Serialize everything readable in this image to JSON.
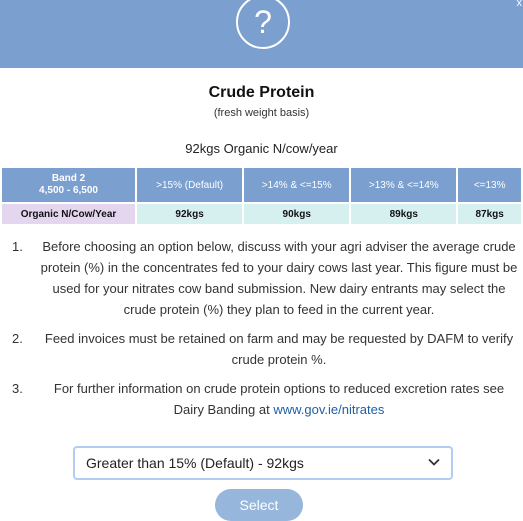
{
  "header": {
    "help_glyph": "?",
    "close_glyph": "x"
  },
  "dialog": {
    "title": "Crude Protein",
    "subtitle": "(fresh weight basis)",
    "summary": "92kgs Organic N/cow/year"
  },
  "table": {
    "band_line1": "Band 2",
    "band_line2": "4,500 - 6,500",
    "columns": [
      ">15% (Default)",
      ">14% & <=15%",
      ">13% & <=14%",
      "<=13%"
    ],
    "row_label": "Organic N/Cow/Year",
    "values": [
      "92kgs",
      "90kgs",
      "89kgs",
      "87kgs"
    ]
  },
  "notes": [
    {
      "num": "1.",
      "text": "Before choosing an option below, discuss with your agri adviser the average crude protein (%) in the concentrates fed to your dairy cows last year. This figure must be used for your nitrates cow band submission. New dairy entrants may select the crude protein (%) they plan to feed in the current year."
    },
    {
      "num": "2.",
      "text": "Feed invoices must be retained on farm and may be requested by DAFM to verify crude protein %."
    },
    {
      "num": "3.",
      "text": "For further information on crude protein options to reduced excretion rates see Dairy Banding at ",
      "link": "www.gov.ie/nitrates"
    }
  ],
  "select": {
    "value": "Greater than 15% (Default) - 92kgs"
  },
  "button": {
    "label": "Select"
  },
  "colors": {
    "header": "#7b9fcf",
    "value_cell": "#d6f0f0",
    "label_cell": "#e3d6ee",
    "button": "#96b6dc",
    "link": "#1f5fa8"
  }
}
